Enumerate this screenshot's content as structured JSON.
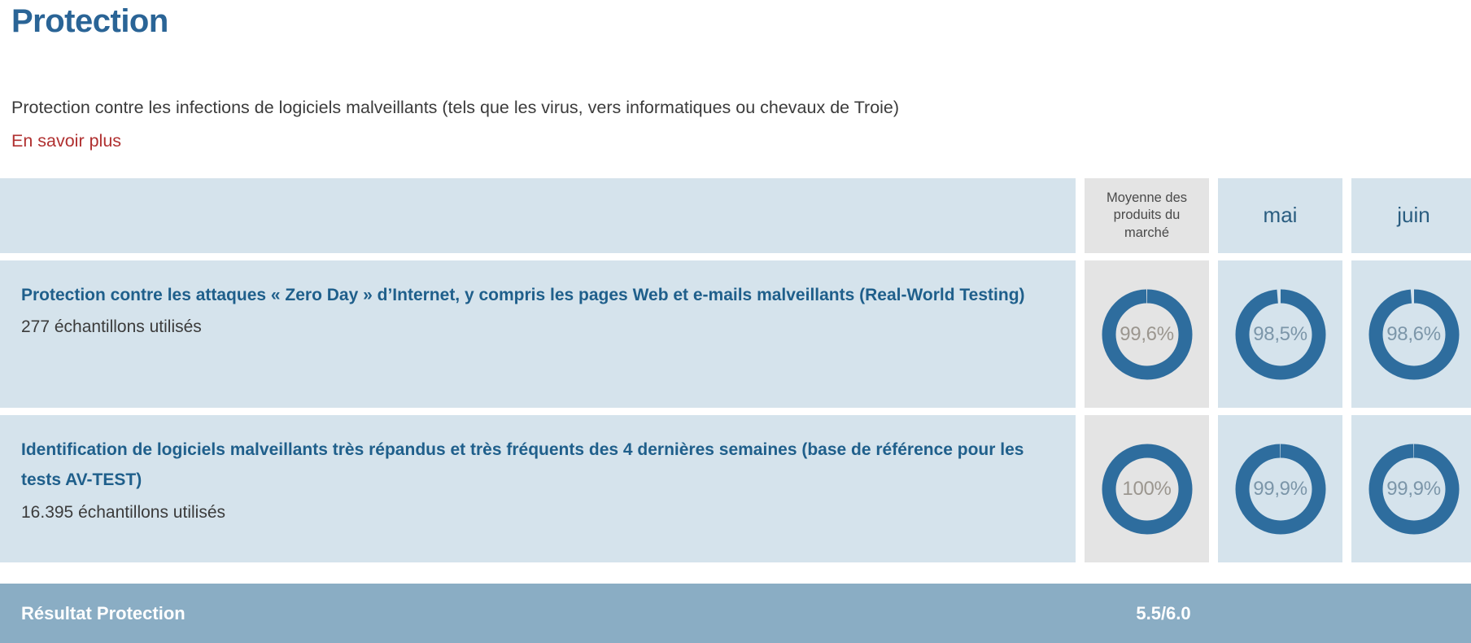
{
  "header": {
    "title": "Protection",
    "description": "Protection contre les infections de logiciels malveillants (tels que les virus, vers informatiques ou chevaux de Troie)",
    "more_link": "En savoir plus"
  },
  "table": {
    "columns": [
      {
        "key": "criterion",
        "label": ""
      },
      {
        "key": "market_average",
        "label": "Moyenne des produits du marché",
        "type": "average"
      },
      {
        "key": "may",
        "label": "mai",
        "type": "month"
      },
      {
        "key": "june",
        "label": "juin",
        "type": "month"
      }
    ],
    "rows": [
      {
        "title": "Protection contre les attaques « Zero Day » d’Internet, y compris les pages Web et e-mails malveillants (Real-World Testing)",
        "subtitle": "277 échantillons utilisés",
        "values": {
          "market_average": "99,6%",
          "may": "98,5%",
          "june": "98,6%"
        }
      },
      {
        "title": "Identification de logiciels malveillants très répandus et très fréquents des 4 dernières semaines (base de référence pour les tests AV-TEST)",
        "subtitle": "16.395 échantillons utilisés",
        "values": {
          "market_average": "100%",
          "may": "99,9%",
          "june": "99,9%"
        }
      }
    ]
  },
  "result": {
    "label": "Résultat Protection",
    "score": "5.5/6.0"
  },
  "chart_data": {
    "type": "pie",
    "title": "Protection",
    "charts": [
      {
        "row": "Protection contre les attaques « Zero Day » d’Internet, y compris les pages Web et e-mails malveillants (Real-World Testing)",
        "series": "Moyenne des produits du marché",
        "value": 99.6,
        "label": "99,6%"
      },
      {
        "row": "Protection contre les attaques « Zero Day » d’Internet, y compris les pages Web et e-mails malveillants (Real-World Testing)",
        "series": "mai",
        "value": 98.5,
        "label": "98,5%"
      },
      {
        "row": "Protection contre les attaques « Zero Day » d’Internet, y compris les pages Web et e-mails malveillants (Real-World Testing)",
        "series": "juin",
        "value": 98.6,
        "label": "98,6%"
      },
      {
        "row": "Identification de logiciels malveillants très répandus et très fréquents des 4 dernières semaines (base de référence pour les tests AV-TEST)",
        "series": "Moyenne des produits du marché",
        "value": 100,
        "label": "100%"
      },
      {
        "row": "Identification de logiciels malveillants très répandus et très fréquents des 4 dernières semaines (base de référence pour les tests AV-TEST)",
        "series": "mai",
        "value": 99.9,
        "label": "99,9%"
      },
      {
        "row": "Identification de logiciels malveillants très répandus et très fréquents des 4 dernières semaines (base de référence pour les tests AV-TEST)",
        "series": "juin",
        "value": 99.9,
        "label": "99,9%"
      }
    ],
    "ylim": [
      0,
      100
    ],
    "legend": "none"
  },
  "colors": {
    "title_blue": "#2a6496",
    "link_red": "#b03030",
    "cell_blue": "#d5e3ec",
    "cell_grey": "#e4e4e4",
    "donut_ring": "#2e6d9e",
    "result_bar": "#8aadc4"
  }
}
